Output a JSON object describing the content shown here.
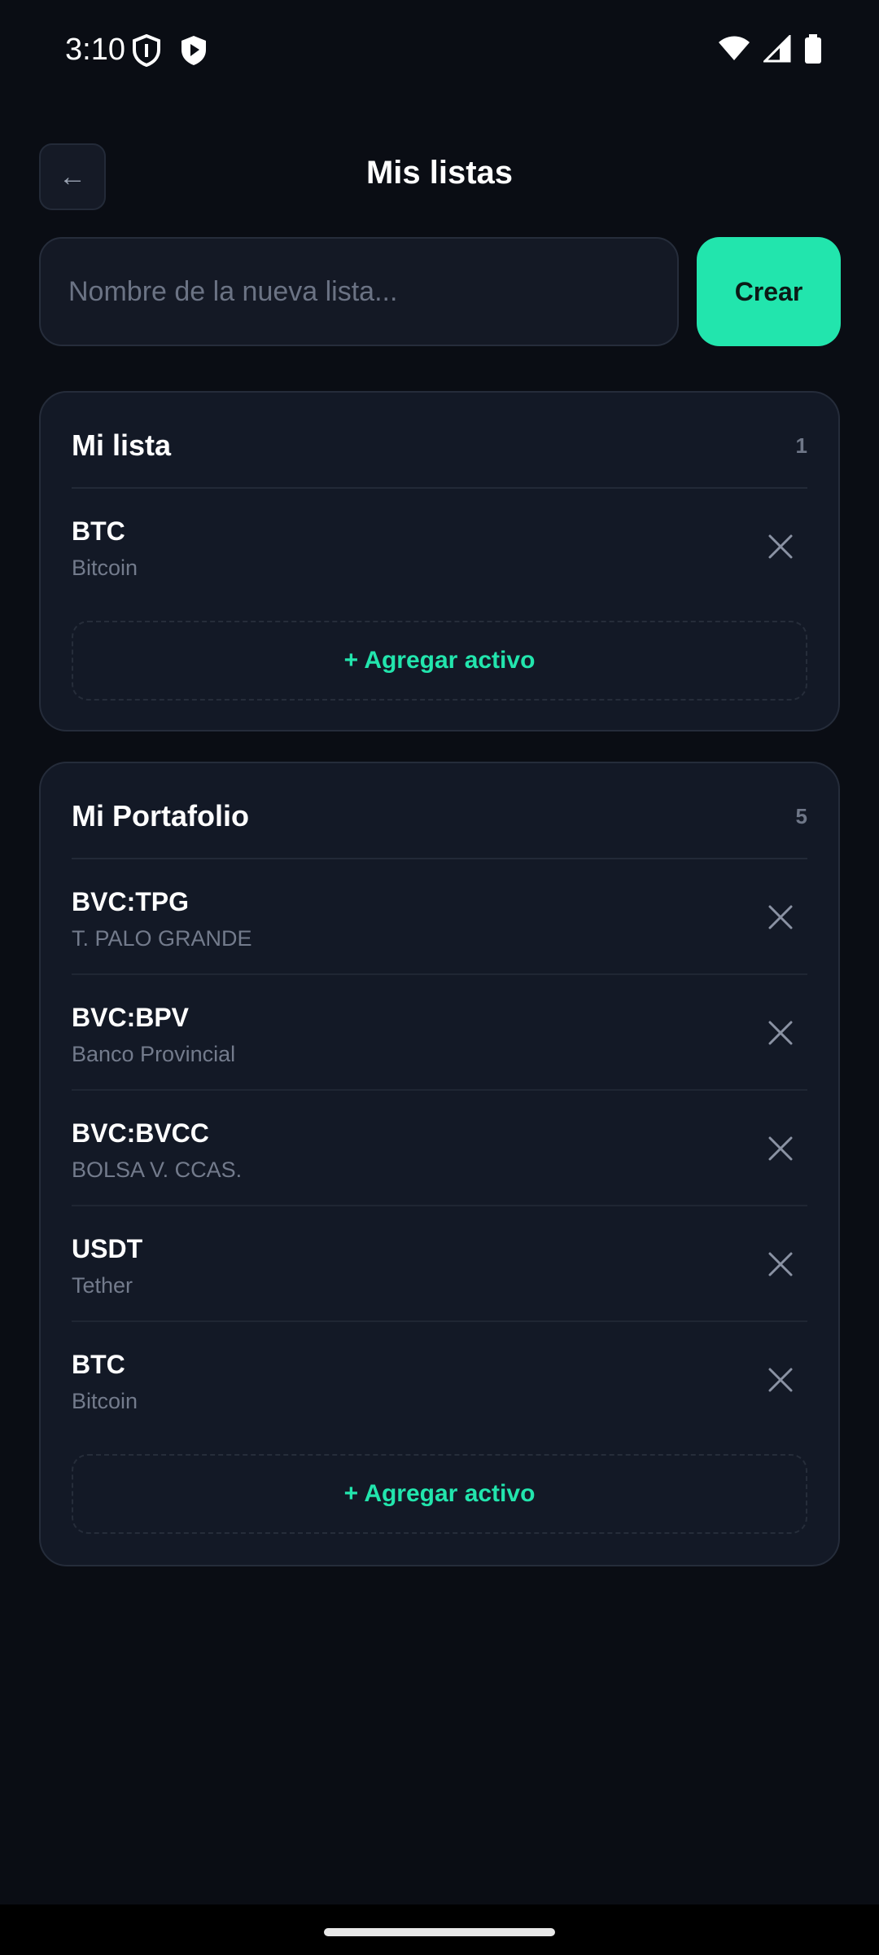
{
  "status_bar": {
    "time": "3:10",
    "left_icons": [
      "shield-outline-icon",
      "shield-play-icon"
    ],
    "right_icons": [
      "wifi-icon",
      "signal-icon",
      "battery-icon"
    ]
  },
  "header": {
    "back_label": "←",
    "title": "Mis listas"
  },
  "create": {
    "input_value": "",
    "placeholder": "Nombre de la nueva lista...",
    "button_label": "Crear"
  },
  "colors": {
    "accent": "#22e5ad",
    "background": "#0a0d14",
    "card": "#131926"
  },
  "lists": [
    {
      "title": "Mi lista",
      "count": "1",
      "assets": [
        {
          "symbol": "BTC",
          "name": "Bitcoin"
        }
      ],
      "add_label": "+ Agregar activo"
    },
    {
      "title": "Mi Portafolio",
      "count": "5",
      "assets": [
        {
          "symbol": "BVC:TPG",
          "name": "T. PALO GRANDE"
        },
        {
          "symbol": "BVC:BPV",
          "name": "Banco Provincial"
        },
        {
          "symbol": "BVC:BVCC",
          "name": "BOLSA V. CCAS."
        },
        {
          "symbol": "USDT",
          "name": "Tether"
        },
        {
          "symbol": "BTC",
          "name": "Bitcoin"
        }
      ],
      "add_label": "+ Agregar activo"
    }
  ]
}
